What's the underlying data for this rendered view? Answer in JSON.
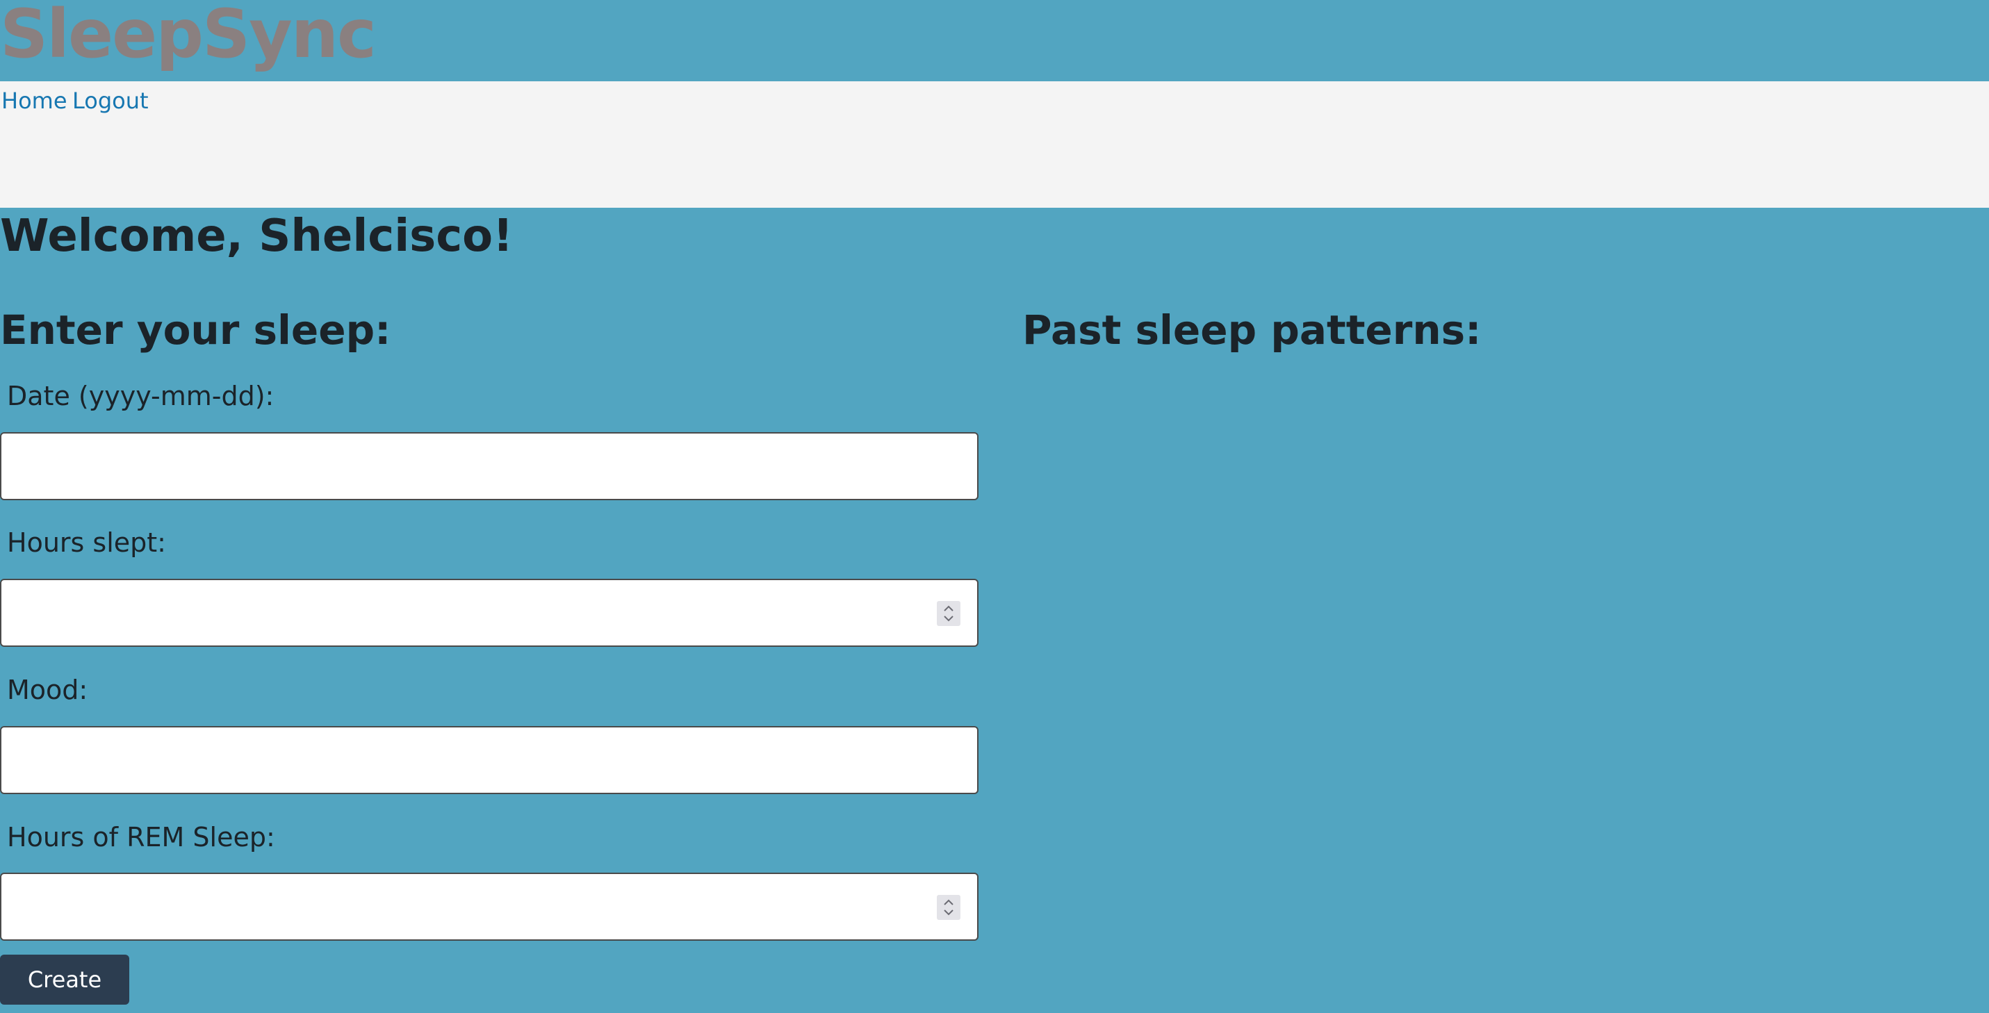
{
  "app": {
    "logo": "SleepSync"
  },
  "nav": {
    "home_label": "Home",
    "logout_label": "Logout"
  },
  "main": {
    "welcome": "Welcome, Shelcisco!",
    "entry_heading": "Enter your sleep:",
    "history_heading": "Past sleep patterns:"
  },
  "form": {
    "date_label": "Date (yyyy-mm-dd):",
    "date_value": "",
    "hours_label": "Hours slept:",
    "hours_value": "",
    "mood_label": "Mood:",
    "mood_value": "",
    "rem_label": "Hours of REM Sleep:",
    "rem_value": "",
    "submit_label": "Create"
  },
  "colors": {
    "page_background": "#52a5c1",
    "nav_background": "#f4f4f4",
    "logo": "#8a8080",
    "link": "#1777b1",
    "button": "#2c3d50"
  },
  "icons": {
    "stepper": "spinner-arrows-icon"
  }
}
